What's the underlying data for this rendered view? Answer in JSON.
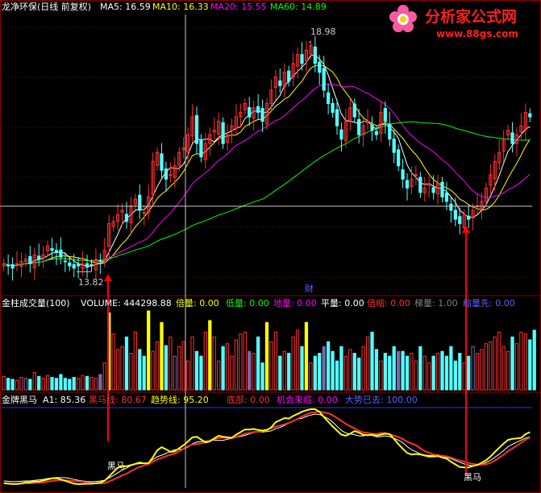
{
  "colors": {
    "background": "#000000",
    "frame": "#8b0000",
    "grid_dot": "#8b0000",
    "up": "#ff3030",
    "down": "#54ffff",
    "ma5": "#ffffff",
    "ma10": "#ffff00",
    "ma20": "#ff00ff",
    "ma60": "#00ff00",
    "crosshair": "#c8c8c8",
    "arrow": "#ff0000",
    "blue_line": "#3030ff",
    "label_blue": "#6060ff"
  },
  "watermark": {
    "brand": "分析家公式网",
    "url": "www.88gs.com"
  },
  "price_panel": {
    "title": "龙净环保(日线 前复权)",
    "ma_labels": [
      {
        "text": "MA5: 16.59",
        "color": "#ffffff"
      },
      {
        "text": "MA10: 16.33",
        "color": "#ffff00"
      },
      {
        "text": "MA20: 15.55",
        "color": "#ff00ff"
      },
      {
        "text": "MA60: 14.89",
        "color": "#00ff00"
      }
    ],
    "high_label": "18.98",
    "low_label": "13.82",
    "event_label": "财"
  },
  "volume_panel": {
    "title": "金柱成交量(100)",
    "labels": [
      {
        "text": "VOLUME: 444298.88",
        "color": "#ffffff"
      },
      {
        "text": "倍量: 0.00",
        "color": "#ffff00"
      },
      {
        "text": "低量: 0.00",
        "color": "#00ff00"
      },
      {
        "text": "地量: 0.00",
        "color": "#ff00ff"
      },
      {
        "text": "平量: 0.00",
        "color": "#ffffff"
      },
      {
        "text": "倍缩: 0.00",
        "color": "#ff3030"
      },
      {
        "text": "梯量: 1.00",
        "color": "#808080"
      },
      {
        "text": "缩量先: 0.00",
        "color": "#6060ff"
      }
    ]
  },
  "indicator_panel": {
    "title": "金牌黑马",
    "labels": [
      {
        "text": "A1: 85.36",
        "color": "#ffffff"
      },
      {
        "text": "黑马线: 80.67",
        "color": "#ff3030"
      },
      {
        "text": "趋势线: 95.20",
        "color": "#ffff00"
      },
      {
        "text": "底部: 0.00",
        "color": "#ff3030"
      },
      {
        "text": "机会来临: 0.00",
        "color": "#ff00ff"
      },
      {
        "text": "大势已去: 100.00",
        "color": "#6060ff"
      }
    ],
    "signal_labels": [
      "黑马",
      "黑马"
    ]
  },
  "chart_data": [
    {
      "type": "candlestick",
      "title": "龙净环保(日线 前复权)",
      "ylim": [
        13.3,
        19.6
      ],
      "high_marker": 18.98,
      "low_marker": 13.82,
      "close": [
        14.0,
        13.95,
        13.9,
        14.0,
        14.05,
        14.1,
        14.0,
        14.2,
        14.1,
        14.2,
        14.4,
        14.3,
        14.25,
        14.15,
        14.05,
        13.95,
        13.9,
        13.95,
        14.0,
        13.92,
        13.95,
        14.1,
        14.05,
        14.3,
        14.9,
        14.95,
        15.1,
        15.2,
        14.95,
        15.3,
        15.45,
        15.2,
        15.15,
        15.5,
        16.3,
        16.5,
        16.1,
        15.9,
        16.0,
        16.2,
        16.5,
        16.6,
        16.9,
        17.3,
        16.7,
        16.4,
        16.7,
        16.9,
        17.0,
        17.2,
        16.7,
        16.9,
        17.1,
        17.3,
        17.4,
        17.6,
        17.3,
        17.5,
        17.4,
        17.2,
        17.6,
        17.9,
        18.2,
        18.0,
        18.3,
        18.1,
        18.5,
        18.7,
        18.5,
        18.8,
        18.9,
        18.5,
        18.3,
        17.9,
        17.6,
        17.4,
        17.1,
        16.8,
        17.2,
        17.5,
        17.3,
        16.9,
        17.1,
        17.2,
        17.0,
        16.9,
        17.4,
        17.2,
        16.8,
        16.5,
        16.2,
        15.9,
        15.7,
        15.9,
        16.0,
        15.6,
        15.7,
        15.8,
        15.6,
        15.8,
        15.5,
        15.4,
        15.2,
        15.0,
        14.9,
        15.1,
        15.0,
        15.2,
        15.3,
        15.4,
        15.7,
        16.0,
        16.3,
        16.5,
        16.8,
        17.0,
        16.7,
        16.9,
        17.1,
        17.4,
        17.3
      ],
      "ma_last": {
        "MA5": 16.59,
        "MA10": 16.33,
        "MA20": 15.55,
        "MA60": 14.89
      }
    },
    {
      "type": "bar",
      "title": "金柱成交量(100)",
      "last_volume": 444298.88,
      "values": [
        14,
        12,
        11,
        10,
        13,
        12,
        11,
        18,
        14,
        12,
        15,
        13,
        12,
        16,
        12,
        11,
        13,
        12,
        15,
        14,
        13,
        12,
        16,
        28,
        80,
        58,
        42,
        45,
        55,
        38,
        60,
        42,
        35,
        82,
        40,
        50,
        70,
        46,
        55,
        35,
        45,
        50,
        30,
        55,
        40,
        35,
        60,
        72,
        55,
        30,
        45,
        48,
        35,
        52,
        58,
        60,
        40,
        38,
        55,
        28,
        70,
        50,
        60,
        35,
        40,
        38,
        55,
        62,
        45,
        70,
        28,
        35,
        38,
        45,
        50,
        40,
        30,
        45,
        35,
        42,
        38,
        33,
        45,
        55,
        60,
        42,
        30,
        38,
        35,
        45,
        40,
        40,
        35,
        38,
        30,
        45,
        35,
        28,
        35,
        38,
        40,
        35,
        45,
        30,
        38,
        28,
        35,
        45,
        38,
        42,
        48,
        50,
        55,
        60,
        45,
        40,
        55,
        48,
        60,
        58,
        52,
        62
      ]
    },
    {
      "type": "line",
      "title": "金牌黑马",
      "ylim": [
        0,
        100
      ],
      "last": {
        "A1": 85.36,
        "黑马线": 80.67,
        "趋势线": 95.2,
        "底部": 0.0,
        "机会来临": 0.0,
        "大势已去": 100.0
      }
    }
  ]
}
